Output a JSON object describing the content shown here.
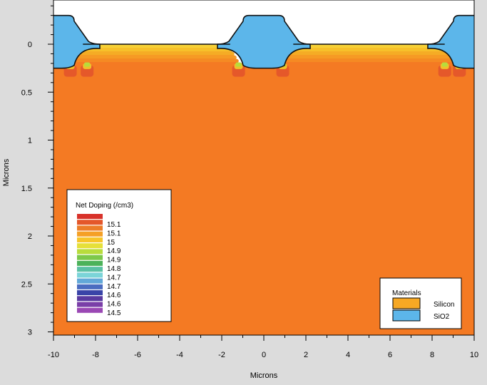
{
  "chart_data": {
    "type": "heatmap",
    "title": "",
    "xlabel": "Microns",
    "ylabel": "Microns",
    "xlim": [
      -10,
      10
    ],
    "ylim": [
      3,
      -0.45
    ],
    "x_ticks": [
      -10,
      -8,
      -6,
      -4,
      -2,
      0,
      2,
      4,
      6,
      8,
      10
    ],
    "y_ticks": [
      0,
      0.5,
      1,
      1.5,
      2,
      2.5,
      3
    ],
    "y_tick_labels": [
      "0",
      "0.5",
      "1",
      "1.5",
      "2",
      "2.5",
      "3"
    ],
    "colorbar": {
      "title": "Net Doping (/cm3)",
      "labels": [
        "15.1",
        "15.1",
        "15",
        "14.9",
        "14.9",
        "14.8",
        "14.7",
        "14.7",
        "14.6",
        "14.6",
        "14.5"
      ],
      "colors": [
        "#d8322a",
        "#e4572a",
        "#ec7d28",
        "#f5a026",
        "#f7c52a",
        "#e6e03a",
        "#b8dc3c",
        "#7cc84a",
        "#4cb25a",
        "#5bc0a4",
        "#7bd4d8",
        "#62a8d8",
        "#4a6cc0",
        "#3a44a8",
        "#5a3aa0",
        "#7a3ea8",
        "#9a48b4"
      ]
    },
    "materials": {
      "title": "Materials",
      "items": [
        {
          "name": "Silicon",
          "color": "#f7a823"
        },
        {
          "name": "SiO2",
          "color": "#5cb6ea"
        }
      ]
    },
    "regions": {
      "background_doping_color": "#f47a23",
      "trench_centers": [
        -10,
        0,
        10
      ],
      "oxide_top_y": -0.3,
      "oxide_bottom_y": 0.25,
      "active_surface_y": 0
    }
  }
}
